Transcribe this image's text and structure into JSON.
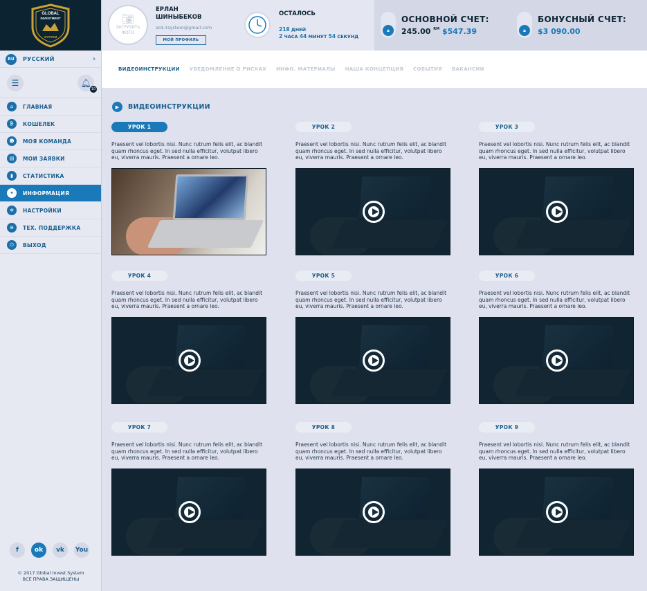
{
  "sidebar": {
    "logo": {
      "line1": "GLOBAL",
      "line2": "INVESTMENT",
      "line3": "SYSTEM"
    },
    "language": {
      "code": "RU",
      "label": "РУССКИЙ"
    },
    "notifications_count": "10",
    "items": [
      {
        "label": "ГЛАВНАЯ",
        "icon": "home-icon",
        "glyph": "⌂",
        "active": false
      },
      {
        "label": "КОШЕЛЕК",
        "icon": "bitcoin-icon",
        "glyph": "₿",
        "active": false
      },
      {
        "label": "МОЯ КОМАНДА",
        "icon": "team-icon",
        "glyph": "☻",
        "active": false
      },
      {
        "label": "МОИ ЗАЯВКИ",
        "icon": "requests-icon",
        "glyph": "▤",
        "active": false
      },
      {
        "label": "СТАТИСТИКА",
        "icon": "stats-icon",
        "glyph": "▮",
        "active": false
      },
      {
        "label": "ИНФОРМАЦИЯ",
        "icon": "lightbulb-icon",
        "glyph": "✦",
        "active": true
      },
      {
        "label": "НАСТРОЙКИ",
        "icon": "gear-icon",
        "glyph": "✲",
        "active": false
      },
      {
        "label": "ТЕХ. ПОДДЕРЖКА",
        "icon": "lifebuoy-icon",
        "glyph": "⊕",
        "active": false
      },
      {
        "label": "ВЫХОД",
        "icon": "power-icon",
        "glyph": "⏻",
        "active": false
      }
    ],
    "socials": [
      {
        "name": "facebook-icon",
        "glyph": "f",
        "active": false
      },
      {
        "name": "odnoklassniki-icon",
        "glyph": "ok",
        "active": true
      },
      {
        "name": "vk-icon",
        "glyph": "vk",
        "active": false
      },
      {
        "name": "youtube-icon",
        "glyph": "You",
        "active": false
      }
    ],
    "copyright_line1": "© 2017 Global Invest System",
    "copyright_line2": "ВСЕ ПРАВА ЗАЩИЩЕНЫ"
  },
  "header": {
    "avatar_text": "ЗАГРУЗИТЬ ФОТО",
    "user_name": "ЕРЛАН ШИНЫБЕКОВ",
    "user_email": "ard.irsystem@gmail.com",
    "profile_button": "МОЙ ПРОФИЛЬ",
    "remaining_title": "ОСТАЛОСЬ",
    "days_value": "218",
    "days_label": "ДНЕЙ",
    "hours_value": "2",
    "hours_label": "ЧАСА",
    "minutes_value": "44",
    "minutes_label": "МИНУТ",
    "seconds_value": "54",
    "seconds_label": "СЕКУНД",
    "main_account": {
      "title": "ОСНОВНОЙ СЧЕТ:",
      "amount": "245.00",
      "unit": "RM",
      "usd": "$547.39"
    },
    "bonus_account": {
      "title": "БОНУСНЫЙ СЧЕТ:",
      "usd": "$3 090.00"
    }
  },
  "tabs": [
    "ВИДЕОИНСТРУКЦИИ",
    "УВЕДОМЛЕНИЕ О РИСКАХ",
    "ИНФО. МАТЕРИАЛЫ",
    "НАША КОНЦЕПЦИЯ",
    "СОБЫТИЯ",
    "ВАКАНСИИ"
  ],
  "section_title": "ВИДЕОИНСТРУКЦИИ",
  "lessons": [
    {
      "label": "УРОК 1",
      "active": true,
      "text": "Praesent vel lobortis nisi. Nunc rutrum felis elit, ac blandit quam rhoncus eget. In sed nulla efficitur, volutpat libero eu, viverra mauris. Praesent a ornare leo."
    },
    {
      "label": "УРОК 2",
      "active": false,
      "text": "Praesent vel lobortis nisi. Nunc rutrum felis elit, ac blandit quam rhoncus eget. In sed nulla efficitur, volutpat libero eu, viverra mauris. Praesent a ornare leo."
    },
    {
      "label": "УРОК 3",
      "active": false,
      "text": "Praesent vel lobortis nisi. Nunc rutrum felis elit, ac blandit quam rhoncus eget. In sed nulla efficitur, volutpat libero eu, viverra mauris. Praesent a ornare leo."
    },
    {
      "label": "УРОК 4",
      "active": false,
      "text": "Praesent vel lobortis nisi. Nunc rutrum felis elit, ac blandit quam rhoncus eget. In sed nulla efficitur, volutpat libero eu, viverra mauris. Praesent a ornare leo."
    },
    {
      "label": "УРОК 5",
      "active": false,
      "text": "Praesent vel lobortis nisi. Nunc rutrum felis elit, ac blandit quam rhoncus eget. In sed nulla efficitur, volutpat libero eu, viverra mauris. Praesent a ornare leo."
    },
    {
      "label": "УРОК 6",
      "active": false,
      "text": "Praesent vel lobortis nisi. Nunc rutrum felis elit, ac blandit quam rhoncus eget. In sed nulla efficitur, volutpat libero eu, viverra mauris. Praesent a ornare leo."
    },
    {
      "label": "УРОК 7",
      "active": false,
      "text": "Praesent vel lobortis nisi. Nunc rutrum felis elit, ac blandit quam rhoncus eget. In sed nulla efficitur, volutpat libero eu, viverra mauris. Praesent a ornare leo."
    },
    {
      "label": "УРОК 8",
      "active": false,
      "text": "Praesent vel lobortis nisi. Nunc rutrum felis elit, ac blandit quam rhoncus eget. In sed nulla efficitur, volutpat libero eu, viverra mauris. Praesent a ornare leo."
    },
    {
      "label": "УРОК 9",
      "active": false,
      "text": "Praesent vel lobortis nisi. Nunc rutrum felis elit, ac blandit quam rhoncus eget. In sed nulla efficitur, volutpat libero eu, viverra mauris. Praesent a ornare leo."
    }
  ],
  "colors": {
    "accent": "#1a79b8",
    "dark": "#0c2432",
    "background": "#dfe1ee"
  }
}
